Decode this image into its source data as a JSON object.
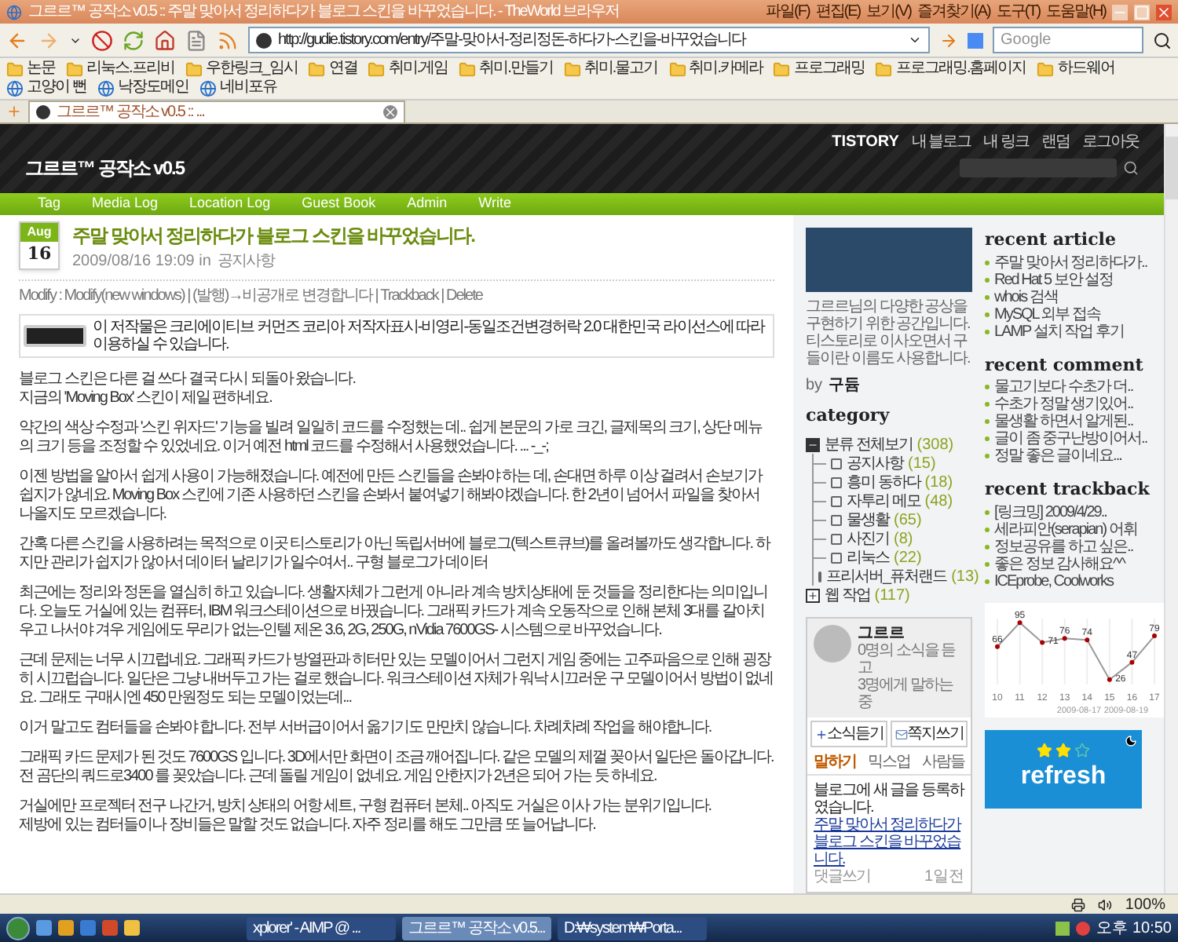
{
  "browser": {
    "title": "그르르™ 공작소 v0.5 :: 주말 맞아서 정리하다가 블로그 스킨을 바꾸었습니다. - TheWorld 브라우저",
    "menu": [
      "파일(F)",
      "편집(E)",
      "보기(V)",
      "즐겨찾기(A)",
      "도구(T)",
      "도움말(H)"
    ],
    "address": "http://gudie.tistory.com/entry/주말-맞아서-정리정돈-하다가-스킨을-바꾸었습니다",
    "search_placeholder": "Google",
    "bookmarks": [
      {
        "label": "논문",
        "kind": "folder"
      },
      {
        "label": "리눅스.프리비",
        "kind": "folder"
      },
      {
        "label": "우한링크_임시",
        "kind": "folder"
      },
      {
        "label": "연결",
        "kind": "folder"
      },
      {
        "label": "취미.게임",
        "kind": "folder"
      },
      {
        "label": "취미.만들기",
        "kind": "folder"
      },
      {
        "label": "취미.물고기",
        "kind": "folder"
      },
      {
        "label": "취미.카메라",
        "kind": "folder"
      },
      {
        "label": "프로그래밍",
        "kind": "folder"
      },
      {
        "label": "프로그래밍.홈페이지",
        "kind": "folder"
      },
      {
        "label": "하드웨어",
        "kind": "folder"
      },
      {
        "label": "고양이 뻔",
        "kind": "link"
      },
      {
        "label": "낙장도메인",
        "kind": "link"
      },
      {
        "label": "네비포유",
        "kind": "link"
      }
    ],
    "tabs": [
      {
        "title": "그르르™ 공작소 v0.5 :: ...",
        "selected": true
      }
    ]
  },
  "blog": {
    "title": "그르르™ 공작소 v0.5",
    "tistory_menu": [
      "TISTORY",
      "내 블로그",
      "내 링크",
      "랜덤",
      "로그아웃"
    ],
    "nav": [
      "Tag",
      "Media Log",
      "Location Log",
      "Guest Book",
      "Admin",
      "Write"
    ]
  },
  "post": {
    "month": "Aug",
    "day": "16",
    "title": "주말 맞아서 정리하다가 블로그 스킨을 바꾸었습니다.",
    "date": "2009/08/16 19:09 in",
    "category": "공지사항",
    "actions": "Modify : Modify(new windows) | (발행)→비공개로 변경합니다 | Trackback | Delete",
    "license": "이 저작물은 크리에이티브 커먼즈 코리아 저작자표시-비영리-동일조건변경허락 2.0 대한민국 라이선스에 따라 이용하실 수 있습니다.",
    "paragraphs": [
      "블로그 스킨은 다른 걸 쓰다 결국 다시 되돌아 왔습니다.\n지금의 'Moving Box' 스킨이 제일 편하네요.",
      "약간의 색상 수정과 '스킨 위자드' 기능을 빌려 일일히 코드를 수정했는 데.. 쉽게 본문의 가로 크긴, 글제목의 크기, 상단 메뉴의 크기 등을 조정할 수 있었네요. 이거 예전 html 코드를 수정해서 사용했었습니다. ... -_-;",
      "이젠 방법을 알아서 쉽게 사용이 가능해졌습니다. 예전에 만든 스킨들을 손봐야 하는 데, 손대면 하루 이상 걸려서 손보기가 쉽지가 않네요. Moving Box 스킨에 기존 사용하던 스킨을 손봐서 붙여넣기 해봐야겠습니다. 한 2년이 넘어서 파일을 찾아서 나올지도 모르겠습니다.",
      "간혹 다른 스킨을 사용하려는 목적으로 이곳 티스토리가 아닌 독립서버에 블로그(텍스트큐브)를 올려볼까도 생각합니다. 하지만 관리가 쉽지가 않아서 데이터 날리기가 일수여서.. 구형 블로그가 데이터",
      "최근에는 정리와 정돈을 열심히 하고 있습니다. 생활자체가 그런게 아니라 계속 방치상태에 둔 것들을 정리한다는 의미입니다. 오늘도 거실에 있는 컴퓨터, IBM 워크스테이션으로 바꿨습니다. 그래픽 카드가 계속 오동작으로 인해 본체 3대를 갈아치우고 나서야 겨우 게임에도 무리가 없는-인텔 제온 3.6, 2G, 250G, nVidia 7600GS- 시스템으로 바꾸었습니다.",
      "근데 문제는 너무 시끄럽네요. 그래픽 카드가 방열판과 히터만 있는 모델이어서 그런지 게임 중에는 고주파음으로 인해 굉장히 시끄럽습니다. 일단은 그냥 내버두고 가는 걸로 했습니다. 워크스테이션 자체가 워낙 시끄러운 구 모델이어서 방법이 없네요. 그래도 구매시엔 450 만원정도 되는 모델이었는데...",
      "이거 말고도 컴터들을 손봐야 합니다. 전부 서버급이어서 옮기기도 만만치 않습니다. 차례차례 작업을 해야합니다.",
      "그래픽 카드 문제가 된 것도 7600GS 입니다. 3D에서만 화면이 조금 깨어집니다. 같은 모델의 제껄 꽂아서 일단은 돌아갑니다. 전 곰단의 쿼드로3400 를 꽂았습니다. 근데 돌릴 게임이 없네요. 게임 안한지가 2년은 되어 가는 듯 하네요.",
      "거실에만 프로젝터 전구 나간거, 방치 상태의 어항 세트, 구형 컴퓨터 본체.. 아직도 거실은 이사 가는 분위기입니다.\n제방에 있는 컴터들이나 장비들은 말할 것도 없습니다. 자주 정리를 해도 그만큼 또 늘어납니다."
    ]
  },
  "sidebar": {
    "description": "그르르님의 다양한 공상을 구현하기 위한 공간입니다. 티스토리로 이사오면서 구들이란 이름도 사용합니다.",
    "by": "by",
    "author": "구듐",
    "category_title": "category",
    "categories": [
      {
        "label": "분류 전체보기",
        "count": "(308)",
        "expanded": true,
        "children": [
          {
            "label": "공지사항",
            "count": "(15)"
          },
          {
            "label": "흥미 동하다",
            "count": "(18)"
          },
          {
            "label": "자투리 메모",
            "count": "(48)"
          },
          {
            "label": "물생활",
            "count": "(65)"
          },
          {
            "label": "사진기",
            "count": "(8)"
          },
          {
            "label": "리눅스",
            "count": "(22)"
          },
          {
            "label": "프리서버_퓨처랜드",
            "count": "(13)"
          }
        ]
      },
      {
        "label": "웹 작업",
        "count": "(117)",
        "expanded": false
      }
    ],
    "profile": {
      "name": "그르르",
      "following": "0명의 소식을 듣고",
      "followers": "3명에게 말하는 중",
      "buttons": [
        "소식듣기",
        "쪽지쓰기"
      ],
      "tabs": [
        {
          "label": "말하기",
          "selected": true
        },
        {
          "label": "믹스업",
          "selected": false
        },
        {
          "label": "사람들",
          "selected": false
        }
      ],
      "message": "블로그에 새 글을 등록하였습니다.",
      "message_link": "주말 맞아서 정리하다가 블로그 스킨을 바꾸었습니다.",
      "reply": "댓글쓰기",
      "time": "1일전"
    },
    "sections": [
      {
        "title": "recent article",
        "items": [
          "주말 맞아서 정리하다가..",
          "Red Hat 5 보안 설정",
          "whois 검색",
          "MySQL 외부 접속",
          "LAMP 설치 작업 후기"
        ]
      },
      {
        "title": "recent comment",
        "items": [
          "물고기보다 수초가 더..",
          "수초가 정말 생기있어..",
          "물생활 하면서 알게된..",
          "글이 좀 중구난방이어서..",
          "정말 좋은 글이네요..."
        ]
      },
      {
        "title": "recent trackback",
        "items": [
          "[링크밍] 2009/4/29..",
          "세라피안(serapian) 어휘",
          "정보공유를 하고 싶은..",
          "좋은 정보 감사해요^^",
          "ICEprobe, Coolworks"
        ]
      }
    ],
    "chart_data": {
      "type": "line",
      "categories": [
        "10",
        "11",
        "12",
        "13",
        "14",
        "15",
        "16",
        "17"
      ],
      "series": [
        {
          "values": [
            66,
            95,
            71,
            76,
            74,
            26,
            47,
            79
          ],
          "marker": true
        }
      ],
      "grid": true,
      "data_labels": true
    },
    "chart_captions": [
      "2009-08-17",
      "2009-08-19"
    ],
    "widget": {
      "label": "refresh",
      "stars": 2
    }
  },
  "status_bar": {
    "zoom": "100%"
  },
  "taskbar": {
    "tasks": [
      {
        "label": "xplorer' - AIMP @ ...",
        "selected": false
      },
      {
        "label": "그르르™ 공작소 v0.5...",
        "selected": true
      },
      {
        "label": "D:₩system₩Porta...",
        "selected": false
      }
    ],
    "clock": "오후 10:50"
  }
}
